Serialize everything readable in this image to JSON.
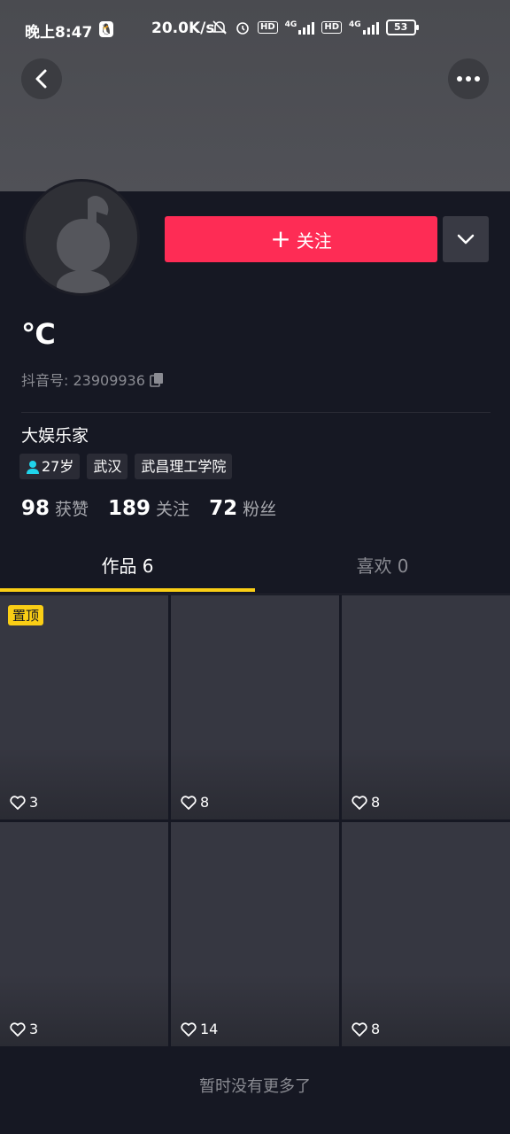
{
  "status_bar": {
    "time": "晚上8:47",
    "speed": "20.0K/s",
    "network_label": "4G",
    "hd_label": "HD",
    "battery": "53"
  },
  "profile": {
    "nickname": "℃",
    "douyin_id": "抖音号: 23909936",
    "bio": "大娱乐家",
    "tags": [
      "27岁",
      "武汉",
      "武昌理工学院"
    ],
    "follow_label": "关注",
    "stats": [
      {
        "value": "98",
        "label": "获赞"
      },
      {
        "value": "189",
        "label": "关注"
      },
      {
        "value": "72",
        "label": "粉丝"
      }
    ]
  },
  "tabs": [
    {
      "label": "作品 6"
    },
    {
      "label": "喜欢 0"
    }
  ],
  "videos": [
    {
      "likes": "3",
      "pinned_label": "置顶"
    },
    {
      "likes": "8"
    },
    {
      "likes": "8"
    },
    {
      "likes": "3"
    },
    {
      "likes": "14"
    },
    {
      "likes": "8"
    }
  ],
  "footer": "暂时没有更多了",
  "colors": {
    "accent": "#fe2c55",
    "highlight": "#face15",
    "background": "#161823"
  }
}
